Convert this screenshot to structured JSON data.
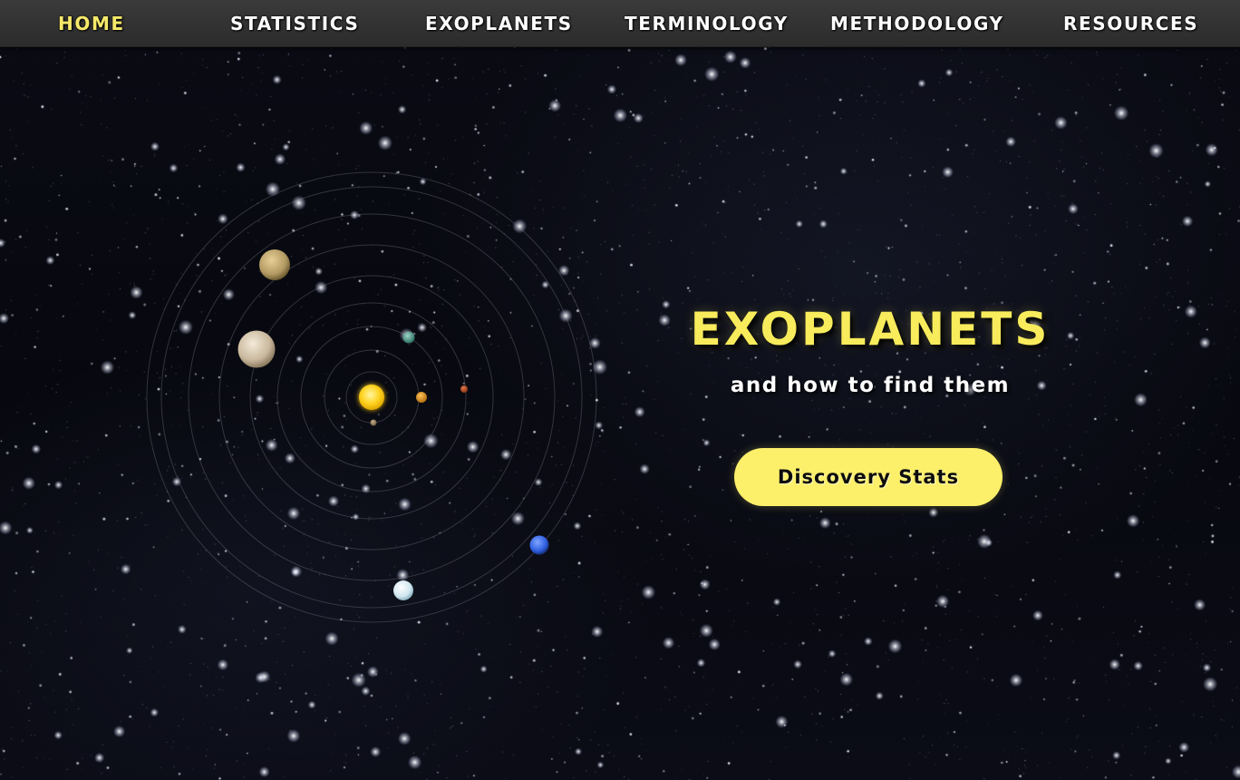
{
  "nav": {
    "items": [
      {
        "label": "HOME",
        "active": true
      },
      {
        "label": "STATISTICS",
        "active": false
      },
      {
        "label": "EXOPLANETS",
        "active": false
      },
      {
        "label": "TERMINOLOGY",
        "active": false
      },
      {
        "label": "METHODOLOGY",
        "active": false
      },
      {
        "label": "RESOURCES",
        "active": false
      }
    ]
  },
  "hero": {
    "title": "EXOPLANETS",
    "subtitle": "and how to find them",
    "cta_label": "Discovery Stats"
  },
  "colors": {
    "accent": "#f8ec5c",
    "button_bg": "#fcef6a",
    "nav_bg": "#333333",
    "background": "#07080f",
    "sun": "#ffd21f"
  }
}
